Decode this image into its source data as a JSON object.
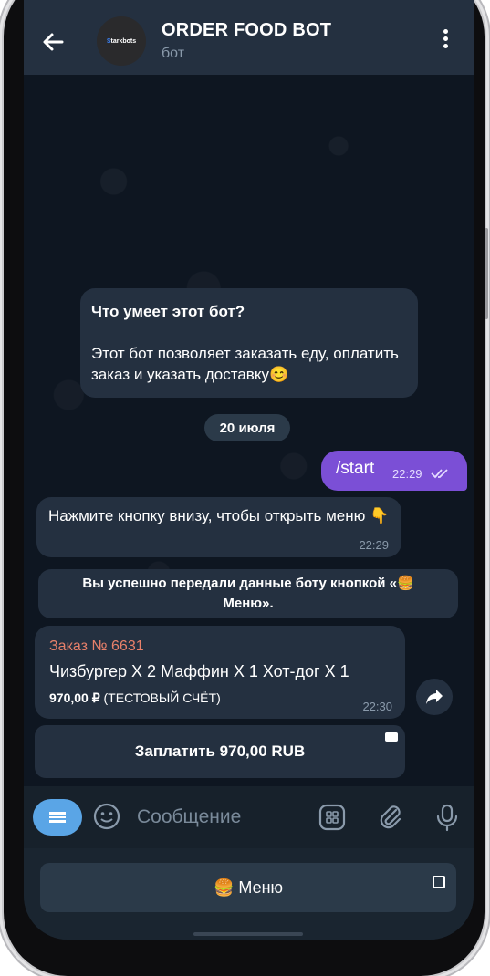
{
  "header": {
    "title": "ORDER FOOD BOT",
    "subtitle": "бот",
    "avatar_text_prefix": "S",
    "avatar_text": "tarkbots",
    "back_icon": "arrow-left-icon",
    "menu_icon": "more-vertical-icon"
  },
  "intro": {
    "heading": "Что умеет этот бот?",
    "body": "Этот бот позволяет заказать еду, оплатить заказ и указать доставку",
    "emoji": "😊"
  },
  "date_separator": "20 июля",
  "outgoing": {
    "text": "/start",
    "time": "22:29",
    "status_icon": "double-check-icon"
  },
  "bot_message": {
    "text": "Нажмите кнопку внизу, чтобы открыть меню",
    "emoji": "👇",
    "time": "22:29"
  },
  "service_message": {
    "line1": "Вы успешно передали данные боту кнопкой «🍔",
    "line2": "Меню»."
  },
  "invoice": {
    "number": "Заказ № 6631",
    "items": "Чизбургер X 2 Маффин X 1 Хот-дог X 1",
    "amount": "970,00 ₽",
    "note": "(ТЕСТОВЫЙ СЧЁТ)",
    "time": "22:30"
  },
  "pay_button": {
    "label": "Заплатить 970,00 RUB"
  },
  "composer": {
    "placeholder": "Сообщение",
    "icons": [
      "menu-icon",
      "emoji-icon",
      "sticker-icon",
      "attach-icon",
      "microphone-icon"
    ]
  },
  "keyboard": {
    "button_label": "🍔 Меню"
  },
  "colors": {
    "header_bg": "#243040",
    "chat_bg": "#0e1621",
    "outgoing_bubble": "#7b4fd6",
    "incoming_bubble": "#243040",
    "accent": "#5aa5e6",
    "invoice_number": "#e8806a"
  }
}
